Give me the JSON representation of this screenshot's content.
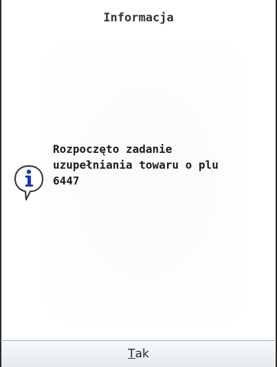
{
  "dialog": {
    "title": "Informacja",
    "message": "Rozpoczęto zadanie\nuzupełniania towaru o plu\n6447",
    "icon": "info-icon",
    "buttons": {
      "yes": {
        "accel": "T",
        "rest": "ak"
      }
    }
  },
  "colors": {
    "icon_blue": "#1e2fd0",
    "frame": "#2a2a2a",
    "text": "#1a1a1a"
  }
}
